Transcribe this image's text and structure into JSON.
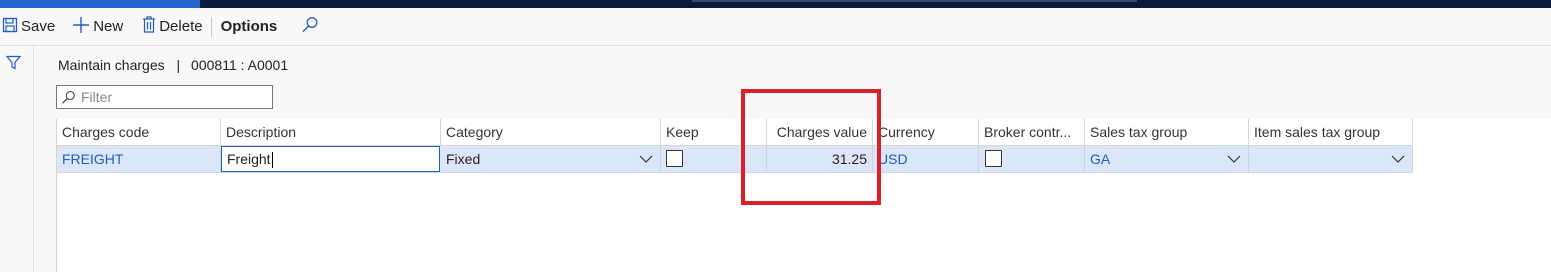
{
  "actions": {
    "save": "Save",
    "new": "New",
    "delete": "Delete",
    "options": "Options"
  },
  "caption": {
    "title": "Maintain charges",
    "separator": "|",
    "record": "000811 : A0001"
  },
  "filter": {
    "placeholder": "Filter",
    "value": ""
  },
  "grid": {
    "columns": [
      "Charges code",
      "Description",
      "Category",
      "Keep",
      "Charges value",
      "Currency",
      "Broker contr...",
      "Sales tax group",
      "Item sales tax group"
    ],
    "rows": [
      {
        "charges_code": "FREIGHT",
        "description": "Freight",
        "category": "Fixed",
        "keep": false,
        "charges_value": "31.25",
        "currency": "USD",
        "broker_contribution": false,
        "sales_tax_group": "GA",
        "item_sales_tax_group": ""
      }
    ]
  },
  "colors": {
    "accent": "#1f5fbf",
    "highlight": "#dd1f2a",
    "selected_row": "#dbe6f8"
  },
  "icons": [
    "save-icon",
    "plus-icon",
    "trash-icon",
    "search-icon",
    "filter-funnel-icon",
    "chevron-down-icon"
  ]
}
